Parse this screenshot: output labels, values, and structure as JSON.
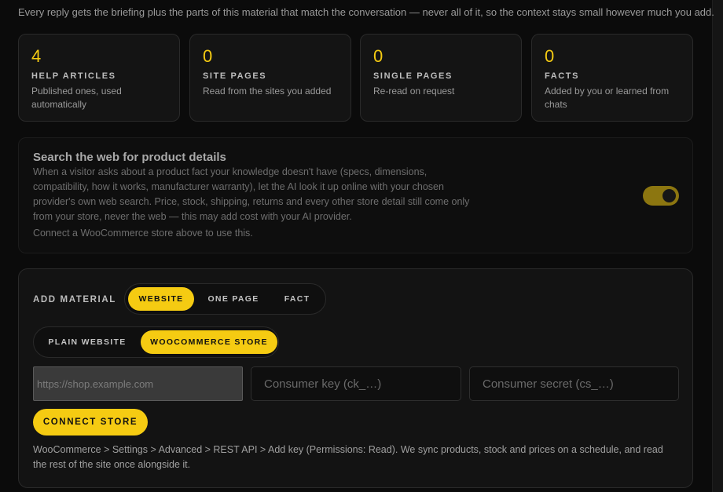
{
  "intro": "Every reply gets the briefing plus the parts of this material that match the conversation — never all of it, so the context stays small however much you add.",
  "stats": [
    {
      "value": "4",
      "label": "HELP ARTICLES",
      "desc": "Published ones, used automatically"
    },
    {
      "value": "0",
      "label": "SITE PAGES",
      "desc": "Read from the sites you added"
    },
    {
      "value": "0",
      "label": "SINGLE PAGES",
      "desc": "Re-read on request"
    },
    {
      "value": "0",
      "label": "FACTS",
      "desc": "Added by you or learned from chats"
    }
  ],
  "web_search": {
    "title": "Search the web for product details",
    "desc": "When a visitor asks about a product fact your knowledge doesn't have (specs, dimensions, compatibility, how it works, manufacturer warranty), let the AI look it up online with your chosen provider's own web search. Price, stock, shipping, returns and every other store detail still come only from your store, never the web — this may add cost with your AI provider.",
    "note": "Connect a WooCommerce store above to use this.",
    "toggle_on": true
  },
  "add_material": {
    "label": "ADD MATERIAL",
    "type_tabs": [
      {
        "label": "WEBSITE",
        "active": true
      },
      {
        "label": "ONE PAGE",
        "active": false
      },
      {
        "label": "FACT",
        "active": false
      }
    ],
    "source_tabs": [
      {
        "label": "PLAIN WEBSITE",
        "active": false
      },
      {
        "label": "WOOCOMMERCE STORE",
        "active": true
      }
    ],
    "url_placeholder": "https://shop.example.com",
    "key_placeholder": "Consumer key (ck_…)",
    "secret_placeholder": "Consumer secret (cs_…)",
    "connect_label": "CONNECT STORE",
    "help": "WooCommerce > Settings > Advanced > REST API > Add key (Permissions: Read). We sync products, stock and prices on a schedule, and read the rest of the site once alongside it."
  },
  "colors": {
    "accent": "#f5cb12",
    "background": "#0b0b0b",
    "card": "#141414"
  }
}
